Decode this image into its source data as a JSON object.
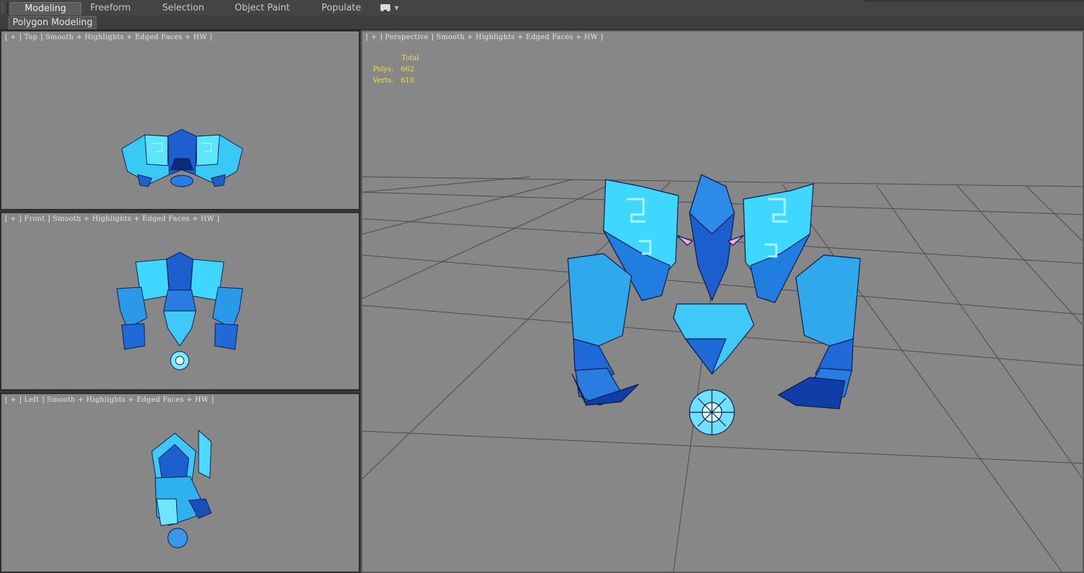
{
  "ribbon": {
    "tabs": [
      {
        "label": "Modeling",
        "active": true
      },
      {
        "label": "Freeform"
      },
      {
        "label": "Selection"
      },
      {
        "label": "Object Paint"
      },
      {
        "label": "Populate"
      }
    ],
    "panel_label": "Polygon Modeling",
    "dropdown_icon": "ribbon-options-icon"
  },
  "viewports": {
    "top": {
      "label": "[ + ] Top ] Smooth + Highlights + Edged Faces + HW ]"
    },
    "front": {
      "label": "[ + ] Front ] Smooth + Highlights + Edged Faces + HW ]"
    },
    "left": {
      "label": "[ + ] Left ] Smooth + Highlights + Edged Faces + HW ]"
    },
    "perspective": {
      "label": "[ + ] Perspective ] Smooth + Highlights + Edged Faces + HW ]",
      "stats": {
        "header": "Total",
        "polys_label": "Polys:",
        "polys": "662",
        "verts_label": "Verts:",
        "verts": "610"
      }
    }
  },
  "colors": {
    "viewport_bg": "#878787",
    "model_light": "#3fd6ff",
    "model_dark": "#1646b8",
    "stats_text": "#f4e23c"
  }
}
